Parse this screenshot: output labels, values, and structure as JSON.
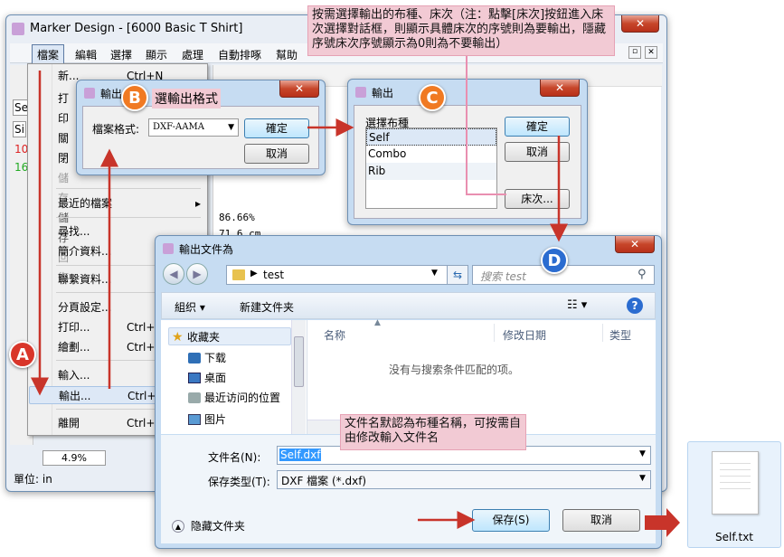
{
  "main_window": {
    "title": "Marker Design - [6000 Basic T Shirt]",
    "menu": [
      "檔案",
      "編輯",
      "選擇",
      "顯示",
      "處理",
      "自動排啄",
      "幫助"
    ],
    "status": "單位: in",
    "zoom": "4.9%",
    "percent": "86.66%",
    "value2": "71.6 cm",
    "left_fragments": [
      "Se",
      "Si",
      "10",
      "16"
    ],
    "side_fragments": [
      "打印",
      "關閉",
      "儲存",
      "儲存",
      "回復"
    ]
  },
  "file_menu": {
    "items": [
      {
        "label": "新...",
        "shortcut": "Ctrl+N"
      },
      {
        "label": "最近的檔案",
        "shortcut": ""
      },
      {
        "label": "尋找...",
        "shortcut": ""
      },
      {
        "label": "簡介資料...",
        "shortcut": ""
      },
      {
        "label": "聯繫資料...",
        "shortcut": ""
      },
      {
        "label": "分頁設定...",
        "shortcut": ""
      },
      {
        "label": "打印...",
        "shortcut": "Ctrl+"
      },
      {
        "label": "繪劃...",
        "shortcut": "Ctrl+"
      },
      {
        "label": "輸入...",
        "shortcut": ""
      },
      {
        "label": "輸出...",
        "shortcut": "Ctrl+"
      },
      {
        "label": "離開",
        "shortcut": "Ctrl+"
      }
    ]
  },
  "dialog_b": {
    "title": "輸出",
    "heading": "選輸出格式",
    "format_label": "檔案格式:",
    "format_value": "DXF-AAMA",
    "ok": "確定",
    "cancel": "取消"
  },
  "dialog_c": {
    "title": "輸出",
    "list_label": "選擇布種",
    "items": [
      "Self",
      "Combo",
      "Rib"
    ],
    "ok": "確定",
    "cancel": "取消",
    "lay_button": "床次..."
  },
  "save_dialog": {
    "title": "輸出文件為",
    "path": "test",
    "search_placeholder": "搜索 test",
    "organize": "組织 ▾",
    "new_folder": "新建文件夹",
    "col_name": "名称",
    "col_date": "修改日期",
    "col_type": "类型",
    "empty_msg": "没有与搜索条件匹配的项。",
    "nav": [
      "收藏夹",
      "下载",
      "桌面",
      "最近访问的位置",
      "图片"
    ],
    "filename_label": "文件名(N):",
    "filename_value": "Self.dxf",
    "type_label": "保存类型(T):",
    "type_value": "DXF 檔案 (*.dxf)",
    "hide_folders": "隐藏文件夹",
    "save": "保存(S)",
    "cancel": "取消"
  },
  "notes": {
    "top": "按需選擇輸出的布種、床次（注：點擊[床次]按鈕進入床次選擇對話框，則顯示具體床次的序號則為要輸出，隱藏序號床次序號顯示為0則為不要輸出）",
    "filename": "文件名默認為布種名稱，可按需自由修改輸入文件名"
  },
  "markers": {
    "a": "A",
    "b": "B",
    "c": "C",
    "d": "D"
  },
  "result_file": {
    "name": "Self.txt"
  },
  "colors": {
    "accent_red": "#d9362a",
    "orange": "#f07a23",
    "blue": "#2b6cd0",
    "note_bg": "#f2cad4"
  }
}
